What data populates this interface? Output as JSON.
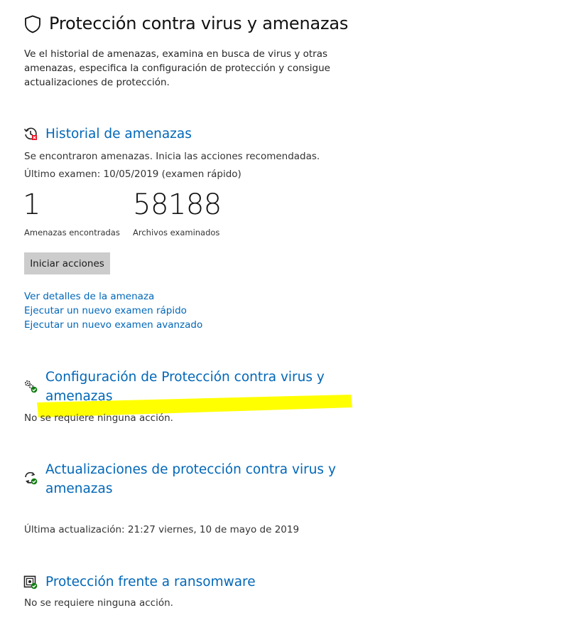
{
  "header": {
    "title": "Protección contra virus y amenazas",
    "description": "Ve el historial de amenazas, examina en busca de virus y otras amenazas, especifica la configuración de protección y consigue actualizaciones de protección."
  },
  "threat_history": {
    "title": "Historial de amenazas",
    "status": "Se encontraron amenazas. Inicia las acciones recomendadas.",
    "last_scan": "Último examen: 10/05/2019 (examen rápido)",
    "threats_found_value": "1",
    "threats_found_label": "Amenazas encontradas",
    "files_scanned_value": "58188",
    "files_scanned_label": "Archivos examinados",
    "start_actions_label": "Iniciar acciones",
    "links": {
      "view_details": "Ver detalles de la amenaza",
      "quick_scan": "Ejecutar un nuevo examen rápido",
      "advanced_scan": "Ejecutar un nuevo examen avanzado"
    }
  },
  "settings": {
    "title_line1": "Configuración de Protección contra virus y",
    "title_line2": "amenazas",
    "status": "No se requiere ninguna acción."
  },
  "updates": {
    "title_line1": "Actualizaciones de protección contra virus y",
    "title_line2": "amenazas",
    "last_update": "Última actualización: 21:27 viernes, 10 de mayo de 2019"
  },
  "ransomware": {
    "title": "Protección frente a ransomware",
    "status": "No se requiere ninguna acción."
  },
  "colors": {
    "link_blue": "#0067b8",
    "highlight_yellow": "#ffff00",
    "ok_green": "#107c10",
    "alert_red": "#e81123"
  }
}
